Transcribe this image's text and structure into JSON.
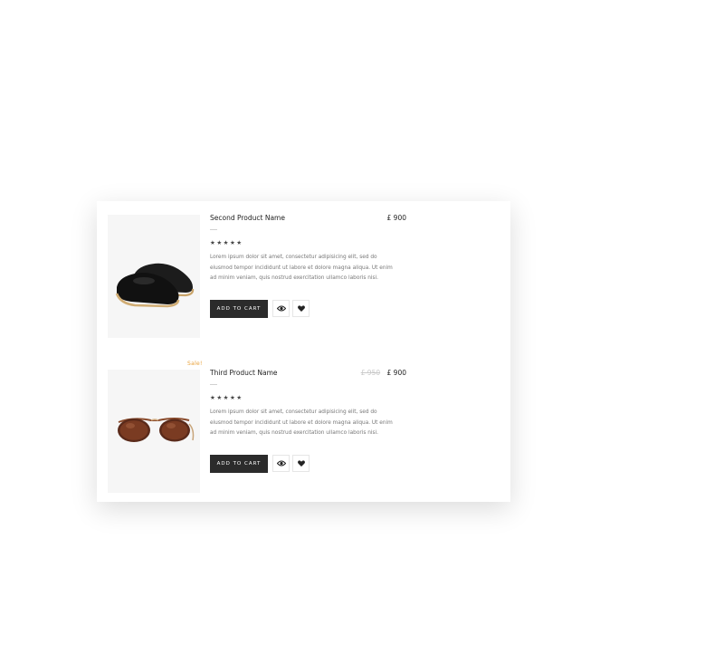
{
  "products": [
    {
      "name": "Second Product Name",
      "old_price": "",
      "price": "£ 900",
      "badge": "",
      "stars": "★★★★★",
      "description": "Lorem ipsum dolor sit amet, consectetur adipisicing elit, sed do eiusmod tempor incididunt ut labore et dolore magna aliqua. Ut enim ad minim veniam, quis nostrud exercitation ullamco laboris nisi.",
      "add_to_cart_label": "ADD TO CART",
      "image": "black-slip-on-shoes"
    },
    {
      "name": "Third Product Name",
      "old_price": "£ 950",
      "price": "£ 900",
      "badge": "Sale!",
      "stars": "★★★★★",
      "description": "Lorem ipsum dolor sit amet, consectetur adipisicing elit, sed do eiusmod tempor incididunt ut labore et dolore magna aliqua. Ut enim ad minim veniam, quis nostrud exercitation ullamco laboris nisi.",
      "add_to_cart_label": "ADD TO CART",
      "image": "brown-sunglasses"
    }
  ],
  "icons": {
    "quick_view": "eye-icon",
    "wishlist": "heart-icon"
  },
  "colors": {
    "button_bg": "#2b2b2b",
    "sale_badge": "#e8a13a",
    "old_price": "#c9c9c9"
  }
}
